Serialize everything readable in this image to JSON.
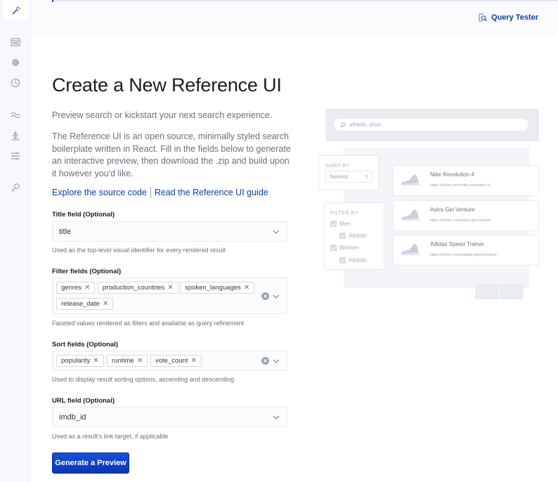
{
  "sidebar": {
    "logo_icon": "magic-wand-icon",
    "items": [
      {
        "name": "sidebar-item-indexes",
        "icon": "table-icon"
      },
      {
        "name": "sidebar-item-settings",
        "icon": "gear-icon"
      },
      {
        "name": "sidebar-item-history",
        "icon": "clock-icon"
      },
      {
        "name": "sidebar-item-relevance",
        "icon": "approx-icon"
      },
      {
        "name": "sidebar-item-ranking",
        "icon": "tree-icon"
      },
      {
        "name": "sidebar-item-tuning",
        "icon": "sliders-icon"
      },
      {
        "name": "sidebar-item-api-keys",
        "icon": "key-icon"
      }
    ]
  },
  "header": {
    "query_tester_label": "Query Tester",
    "query_tester_icon": "magnify-doc-icon"
  },
  "page": {
    "title": "Create a New Reference UI",
    "lead": "Preview search or kickstart your next search experience.",
    "description": "The Reference UI is an open source, minimally styled search boilerplate written in React. Fill in the fields below to generate an interactive preview, then download the .zip and build upon it however you'd like.",
    "links": {
      "source_code": "Explore the source code",
      "guide": "Read the Reference UI guide"
    }
  },
  "form": {
    "title_field": {
      "label": "Title field (Optional)",
      "value": "title",
      "help": "Used as the top-level visual identifier for every rendered result"
    },
    "filter_fields": {
      "label": "Filter fields (Optional)",
      "values": [
        "genres",
        "production_countries",
        "spoken_languages",
        "release_date"
      ],
      "help": "Faceted values rendered as filters and available as query refinement"
    },
    "sort_fields": {
      "label": "Sort fields (Optional)",
      "values": [
        "popularity",
        "runtime",
        "vote_count"
      ],
      "help": "Used to display result sorting options, ascending and descending"
    },
    "url_field": {
      "label": "URL field (Optional)",
      "value": "imdb_id",
      "help": "Used as a result's link target, if applicable"
    },
    "submit_label": "Generate a Preview"
  },
  "preview_illustration": {
    "search_text": "athletic shoe",
    "sort_heading": "SORT BY",
    "sort_value": "Newest",
    "filter_heading": "FILTER BY",
    "filters": [
      {
        "label": "Men",
        "indent": false
      },
      {
        "label": "Athletic",
        "indent": true
      },
      {
        "label": "Women",
        "indent": false
      },
      {
        "label": "Athletic",
        "indent": true
      }
    ],
    "results": [
      {
        "name": "Nike Revolution 4",
        "url": "https://shoes.com/nike-revolution-4"
      },
      {
        "name": "Asics Gel Venture",
        "url": "https://shoes.com/asics-gel-venture"
      },
      {
        "name": "Adidas Speed Trainer",
        "url": "https://shoes.com/adidas-speed-trainer"
      }
    ],
    "prev_label": "‹",
    "next_label": "›"
  },
  "colors": {
    "accent": "#0b3ea8",
    "primary_button": "#0f3fc7",
    "muted_text": "#69707d",
    "sidebar_bg": "#f7f8fc"
  }
}
